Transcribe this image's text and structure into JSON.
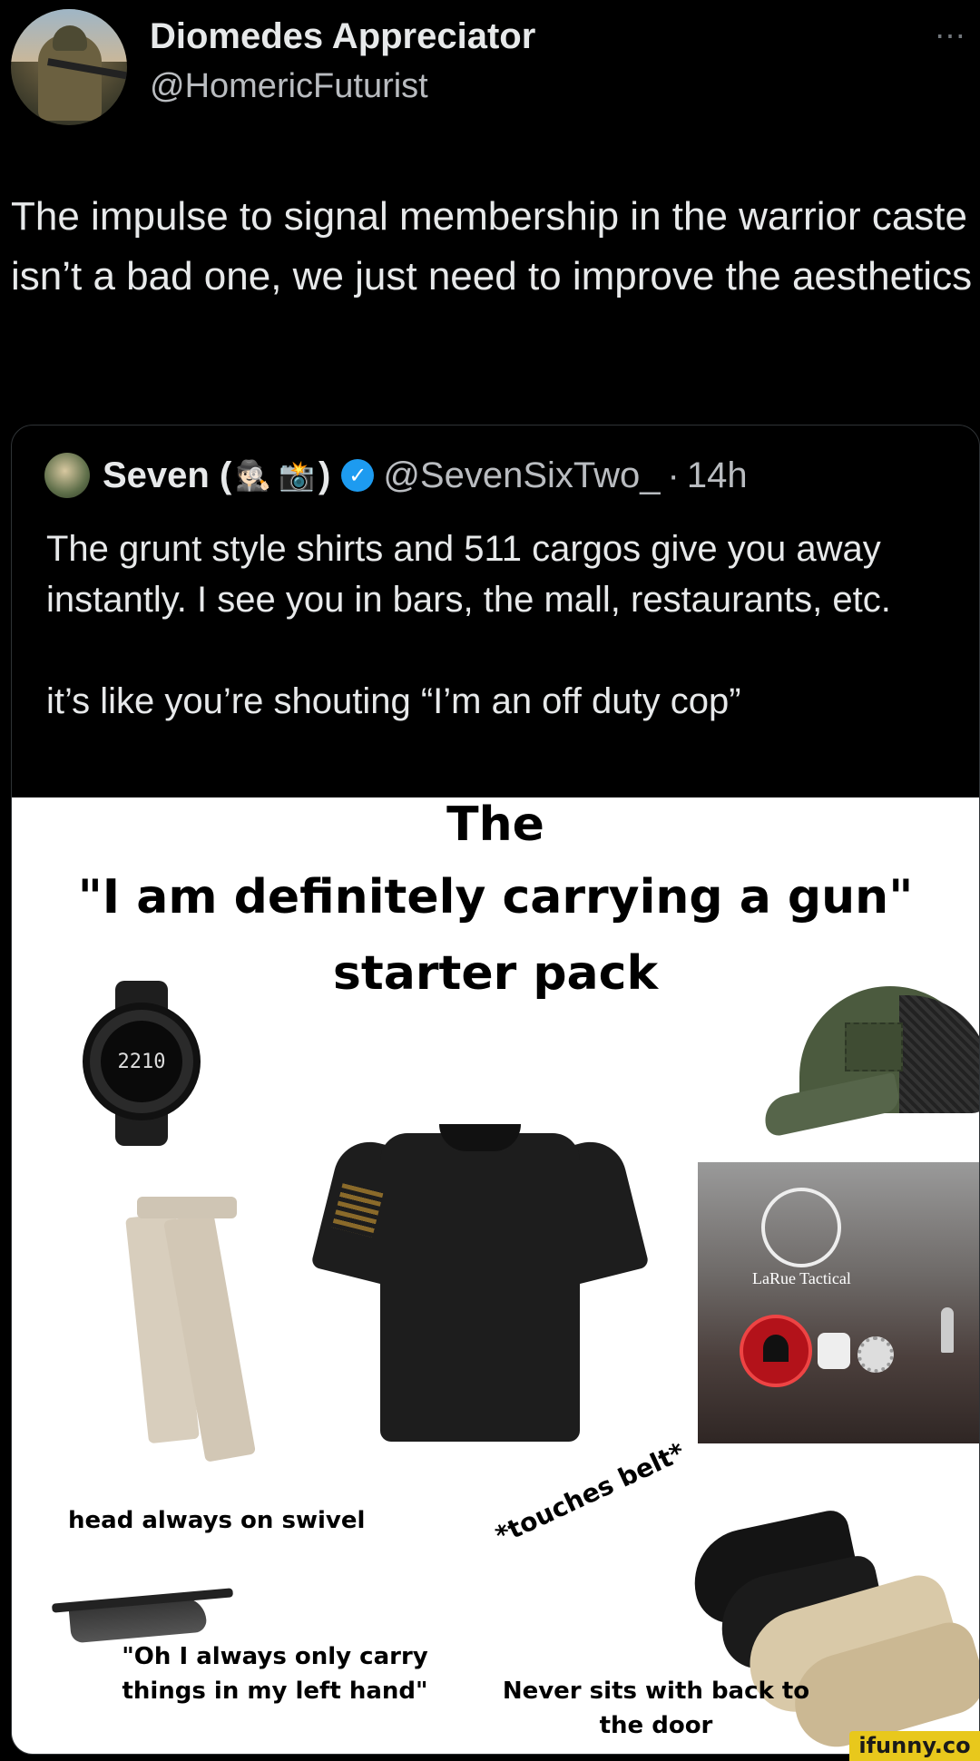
{
  "author": {
    "display_name": "Diomedes Appreciator",
    "handle": "@HomericFuturist",
    "more_icon": "⋯"
  },
  "tweet": {
    "text": "The impulse to signal membership in the warrior caste isn’t a bad one, we just need to improve the aesthetics"
  },
  "quoted": {
    "name_prefix": "Seven (",
    "emoji_1": "🕵🏻",
    "emoji_2": "📸",
    "name_suffix": ")",
    "verified_icon": "✓",
    "handle": "@SevenSixTwo_",
    "separator": "·",
    "time": "14h",
    "paragraph_1": "The grunt style shirts and 511 cargos give you away instantly. I see you in bars, the mall, restaurants, etc.",
    "paragraph_2": "it’s like you’re shouting “I’m an off duty cop”"
  },
  "meme": {
    "title_1": "The",
    "title_2": "\"I am definitely carrying a gun\"",
    "title_3": "starter pack",
    "watch_readout": "2210",
    "truck_logo": "LaRue Tactical",
    "caption_swivel": "head always on swivel",
    "caption_belt": "*touches belt*",
    "caption_left_hand": "\"Oh I always only carry things in my left hand\"",
    "caption_door": "Never sits with back to the door"
  },
  "watermark": "ifunny.co",
  "colors": {
    "background": "#000000",
    "verified": "#1d9bf0",
    "watermark_bg": "#e8c81c"
  }
}
